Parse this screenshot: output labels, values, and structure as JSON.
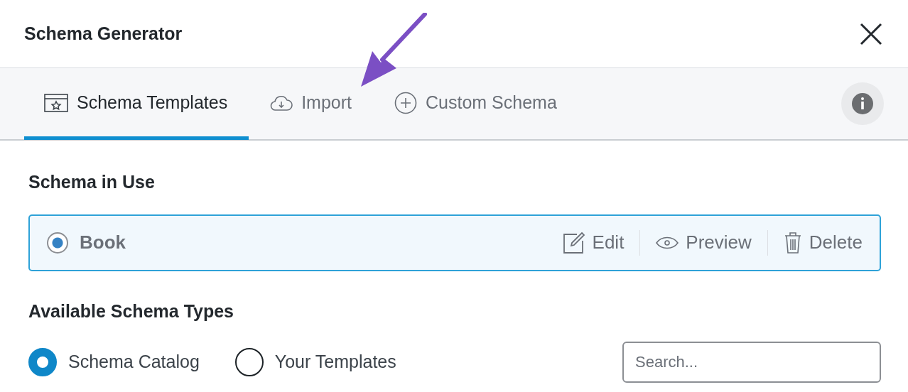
{
  "window": {
    "title": "Schema Generator"
  },
  "tabs": [
    {
      "label": "Schema Templates",
      "kind": "template",
      "selected": true
    },
    {
      "label": "Import",
      "kind": "cloud",
      "selected": false
    },
    {
      "label": "Custom Schema",
      "kind": "plus",
      "selected": false
    }
  ],
  "in_use": {
    "heading": "Schema in Use",
    "item": {
      "name": "Book",
      "selected": true
    },
    "actions": [
      {
        "label": "Edit",
        "kind": "edit"
      },
      {
        "label": "Preview",
        "kind": "eye"
      },
      {
        "label": "Delete",
        "kind": "trash"
      }
    ]
  },
  "available": {
    "heading": "Available Schema Types",
    "sources": [
      {
        "label": "Schema Catalog",
        "selected": true
      },
      {
        "label": "Your Templates",
        "selected": false
      }
    ],
    "search": {
      "placeholder": "Search..."
    }
  }
}
